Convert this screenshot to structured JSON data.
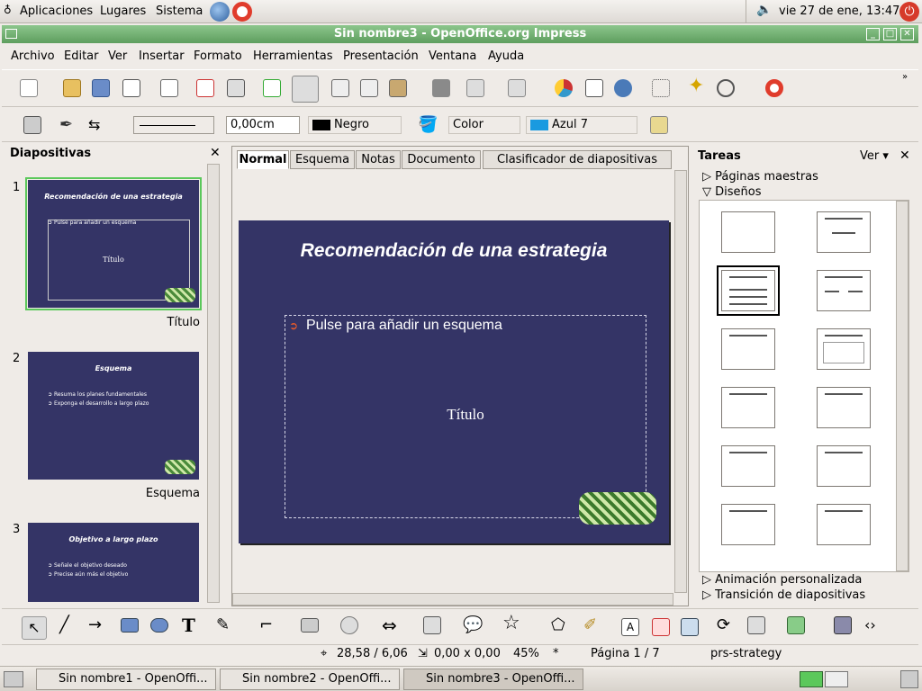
{
  "top_panel": {
    "apps": "Aplicaciones",
    "places": "Lugares",
    "system": "Sistema",
    "clock": "vie 27 de ene, 13:47"
  },
  "window": {
    "title": "Sin nombre3 - OpenOffice.org Impress"
  },
  "menu": [
    "Archivo",
    "Editar",
    "Ver",
    "Insertar",
    "Formato",
    "Herramientas",
    "Presentación",
    "Ventana",
    "Ayuda"
  ],
  "format_bar": {
    "line_width": "0,00cm",
    "line_color": "Negro",
    "area_style": "Color",
    "area_color": "Azul 7"
  },
  "slides_pane": {
    "title": "Diapositivas",
    "slides": [
      {
        "num": "1",
        "title": "Recomendación de una estrategia",
        "bullets": [
          "Pulse para añadir un esquema"
        ],
        "label": "Título",
        "center": "Título"
      },
      {
        "num": "2",
        "title": "Esquema",
        "bullets": [
          "Resuma los planes fundamentales",
          "Exponga el desarrollo a largo plazo"
        ],
        "label": "Esquema"
      },
      {
        "num": "3",
        "title": "Objetivo a largo plazo",
        "bullets": [
          "Señale el objetivo deseado",
          "Precise aún más el objetivo"
        ],
        "label": ""
      }
    ]
  },
  "editor": {
    "tabs": [
      "Normal",
      "Esquema",
      "Notas",
      "Documento",
      "Clasificador de diapositivas"
    ],
    "active_tab": "Normal",
    "slide": {
      "title": "Recomendación de una estrategia",
      "outline": "Pulse para añadir un esquema",
      "center": "Título"
    }
  },
  "tasks": {
    "title": "Tareas",
    "view": "Ver",
    "sections": {
      "master": "Páginas maestras",
      "layouts": "Diseños",
      "animation": "Animación personalizada",
      "transition": "Transición de diapositivas"
    }
  },
  "status": {
    "position": "28,58 / 6,06",
    "size": "0,00 x 0,00",
    "zoom": "45%",
    "modified": "*",
    "page": "Página 1 / 7",
    "master": "prs-strategy"
  },
  "taskbar": {
    "items": [
      "Sin nombre1 - OpenOffi...",
      "Sin nombre2 - OpenOffi...",
      "Sin nombre3 - OpenOffi..."
    ]
  },
  "colors": {
    "slide_bg": "#343466",
    "title_bar": "#6aa86a",
    "accent": "#5bc85b"
  }
}
